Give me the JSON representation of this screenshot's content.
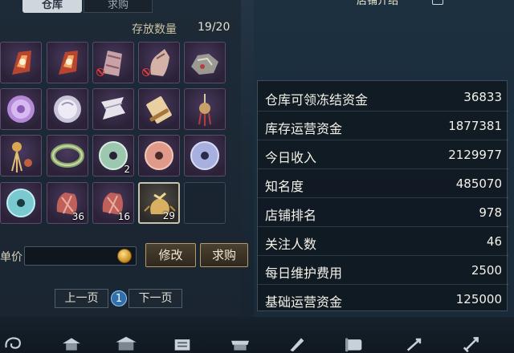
{
  "warehouse": {
    "tabs": [
      {
        "label": "仓库"
      },
      {
        "label": "求购"
      }
    ],
    "capacity_label": "存放数量",
    "capacity_value": "19/20",
    "slots": [
      {
        "icon": "relic-fragment-icon",
        "count": "",
        "locked": false
      },
      {
        "icon": "relic-fragment-icon",
        "count": "",
        "locked": false
      },
      {
        "icon": "bundle-icon",
        "count": "",
        "locked": true
      },
      {
        "icon": "bell-charm-icon",
        "count": "",
        "locked": true
      },
      {
        "icon": "ore-chunk-icon",
        "count": "",
        "locked": false
      },
      {
        "icon": "purple-orb-icon",
        "count": "",
        "locked": false
      },
      {
        "icon": "silver-orb-icon",
        "count": "",
        "locked": false
      },
      {
        "icon": "scroll-ribbon-icon",
        "count": "",
        "locked": false
      },
      {
        "icon": "scroll-icon",
        "count": "",
        "locked": false
      },
      {
        "icon": "pendant-icon",
        "count": "",
        "locked": false
      },
      {
        "icon": "tassel-icon",
        "count": "",
        "locked": false
      },
      {
        "icon": "jade-bracelet-icon",
        "count": "",
        "locked": false
      },
      {
        "icon": "jade-disc-icon",
        "count": "2",
        "locked": false
      },
      {
        "icon": "pink-disc-icon",
        "count": "",
        "locked": false
      },
      {
        "icon": "blue-disc-icon",
        "count": "",
        "locked": false
      },
      {
        "icon": "teal-disc-icon",
        "count": "",
        "locked": false
      },
      {
        "icon": "cloth-bundle-icon",
        "count": "36",
        "locked": false
      },
      {
        "icon": "cloth-bundle-icon",
        "count": "16",
        "locked": false
      },
      {
        "icon": "gold-pouch-icon",
        "count": "29",
        "locked": false
      },
      {
        "icon": "",
        "count": "",
        "locked": false
      }
    ],
    "price_label": "单价",
    "price_value": "",
    "modify_label": "修改",
    "buy_label": "求购",
    "prev_label": "上一页",
    "page": "1",
    "next_label": "下一页"
  },
  "header": {
    "title": "店铺介绍"
  },
  "stats": [
    {
      "label": "仓库可领冻结资金",
      "value": "36833"
    },
    {
      "label": "库存运营资金",
      "value": "1877381"
    },
    {
      "label": "今日收入",
      "value": "2129977"
    },
    {
      "label": "知名度",
      "value": "485070"
    },
    {
      "label": "店铺排名",
      "value": "978"
    },
    {
      "label": "关注人数",
      "value": "46"
    },
    {
      "label": "每日维护费用",
      "value": "2500"
    },
    {
      "label": "基础运营资金",
      "value": "125000"
    }
  ],
  "toolbar": {
    "icons": [
      "swirl-icon",
      "pavilion-icon",
      "building-icon",
      "ledger-icon",
      "shop-icon",
      "brush-icon",
      "scroll-icon",
      "arrow-icon",
      "sword-icon"
    ]
  },
  "colors": {
    "accent_gold": "#b79a62",
    "slot_purple": "#4a3a5e",
    "page_blue": "#2e6fae"
  }
}
